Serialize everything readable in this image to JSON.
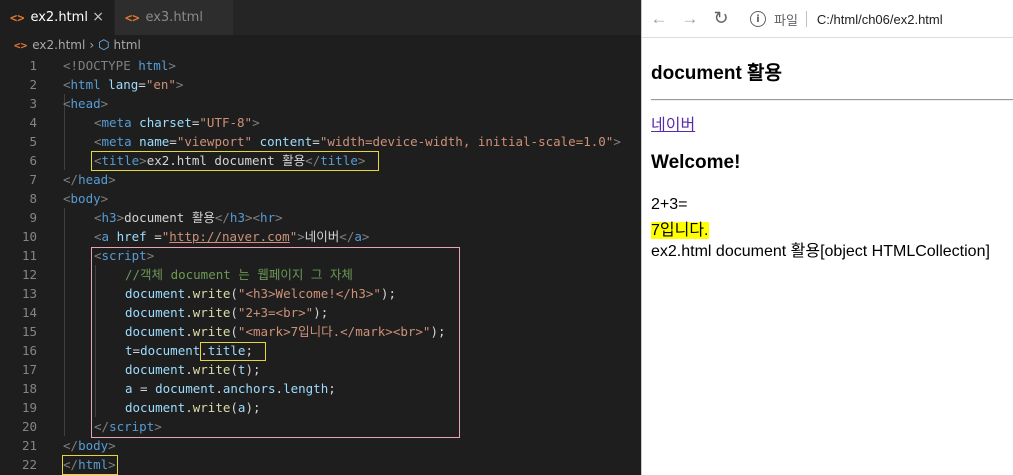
{
  "editor": {
    "tabs": [
      {
        "icon": "<>",
        "label": "ex2.html",
        "close": "×"
      },
      {
        "icon": "<>",
        "label": "ex3.html"
      }
    ],
    "breadcrumb": {
      "file": "ex2.html",
      "separator": "›",
      "symbol": "html"
    },
    "line_numbers": [
      "1",
      "2",
      "3",
      "4",
      "5",
      "6",
      "7",
      "8",
      "9",
      "10",
      "11",
      "12",
      "13",
      "14",
      "15",
      "16",
      "17",
      "18",
      "19",
      "20",
      "21",
      "22"
    ],
    "code": {
      "l1": [
        "<!DOCTYPE",
        " html",
        ">"
      ],
      "l2": [
        "<",
        "html",
        " ",
        "lang",
        "=",
        "\"en\"",
        ">"
      ],
      "l3": [
        "<",
        "head",
        ">"
      ],
      "l4": [
        "<",
        "meta",
        " ",
        "charset",
        "=",
        "\"UTF-8\"",
        ">"
      ],
      "l5": [
        "<",
        "meta",
        " ",
        "name",
        "=",
        "\"viewport\"",
        " ",
        "content",
        "=",
        "\"width=device-width, initial-scale=1.0\"",
        ">"
      ],
      "l6": [
        "<",
        "title",
        ">",
        "ex2.html document 활용",
        "</",
        "title",
        ">"
      ],
      "l7": [
        "</",
        "head",
        ">"
      ],
      "l8": [
        "<",
        "body",
        ">"
      ],
      "l9": [
        "<",
        "h3",
        ">",
        "document 활용",
        "</",
        "h3",
        ">",
        "<",
        "hr",
        ">"
      ],
      "l10": [
        "<",
        "a",
        " ",
        "href",
        " =",
        "\"",
        "http://naver.com",
        "\"",
        ">",
        "네이버",
        "</",
        "a",
        ">"
      ],
      "l11": [
        "<",
        "script",
        ">"
      ],
      "l12": [
        "//객체 document 는 웹페이지 그 자체"
      ],
      "l13": [
        "document",
        ".",
        "write",
        "(",
        "\"<h3>Welcome!</h3>\"",
        ");"
      ],
      "l14": [
        "document",
        ".",
        "write",
        "(",
        "\"2+3=<br>\"",
        ");"
      ],
      "l15": [
        "document",
        ".",
        "write",
        "(",
        "\"<mark>7입니다.</mark><br>\"",
        ");"
      ],
      "l16": [
        "t",
        "=",
        "document",
        ".",
        "title",
        ";"
      ],
      "l17": [
        "document",
        ".",
        "write",
        "(",
        "t",
        ");"
      ],
      "l18": [
        "a",
        " = ",
        "document",
        ".",
        "anchors",
        ".",
        "length",
        ";"
      ],
      "l19": [
        "document",
        ".",
        "write",
        "(",
        "a",
        ");"
      ],
      "l20": [
        "</",
        "script",
        ">"
      ],
      "l21": [
        "</",
        "body",
        ">"
      ],
      "l22": [
        "</",
        "html",
        ">"
      ]
    },
    "colors": {
      "title_box": "#e5d73a",
      "script_box": "#e8a3b8",
      "title_prop_box": "#e5d73a"
    }
  },
  "browser": {
    "nav": {
      "back_icon": "←",
      "forward_icon": "→",
      "reload_icon": "↻"
    },
    "address": {
      "info_icon": "i",
      "scheme": "파일",
      "url": "C:/html/ch06/ex2.html"
    },
    "page": {
      "heading": "document 활용",
      "link": "네이버",
      "welcome": "Welcome!",
      "sum": "2+3=",
      "mark": "7입니다.",
      "tail_title": "ex2.html document 활용",
      "tail_obj": "[object HTMLCollection]"
    }
  }
}
